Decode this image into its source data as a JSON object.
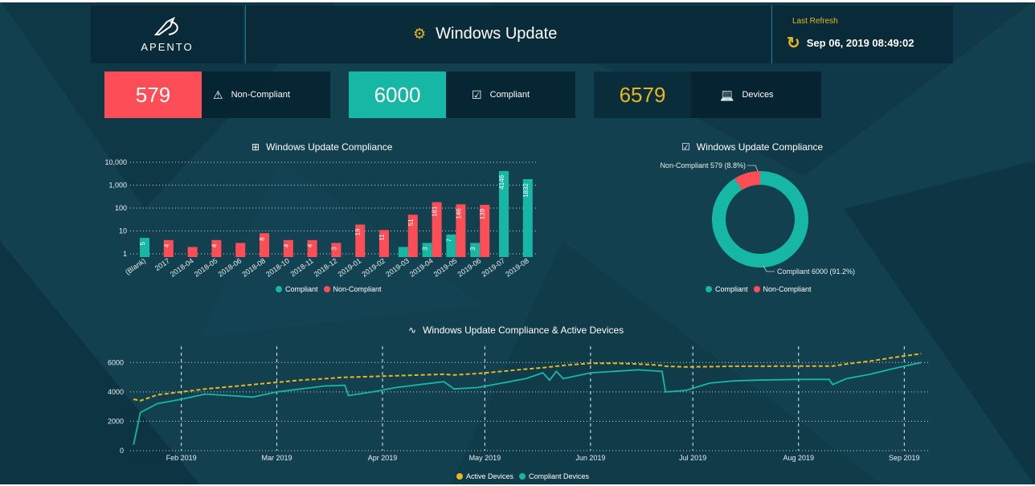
{
  "header": {
    "logo_text": "APENTO",
    "title": "Windows Update",
    "refresh_label": "Last Refresh",
    "refresh_time": "Sep 06, 2019 08:49:02"
  },
  "kpis": [
    {
      "value": "579",
      "label": "Non-Compliant",
      "icon": "warning-icon",
      "color": "#fd4d57"
    },
    {
      "value": "6000",
      "label": "Compliant",
      "icon": "checkbox-icon",
      "color": "#17b7a5"
    },
    {
      "value": "6579",
      "label": "Devices",
      "icon": "laptop-icon",
      "color": "#e8b620"
    }
  ],
  "colors": {
    "compliant": "#17b7a5",
    "noncompliant": "#fd4d57",
    "active": "#e8b620"
  },
  "bar_panel": {
    "title": "Windows Update Compliance",
    "legend": [
      "Compliant",
      "Non-Compliant"
    ]
  },
  "donut_panel": {
    "title": "Windows Update Compliance",
    "label_noncompliant": "Non-Compliant 579 (8.8%)",
    "label_compliant": "Compliant 6000 (91.2%)",
    "legend": [
      "Compliant",
      "Non-Compliant"
    ]
  },
  "line_panel": {
    "title": "Windows Update Compliance & Active Devices",
    "legend": [
      "Active Devices",
      "Compliant Devices"
    ]
  },
  "chart_data": [
    {
      "type": "bar",
      "title": "Windows Update Compliance",
      "y_scale": "log",
      "y_ticks": [
        "1",
        "10",
        "100",
        "1,000",
        "10,000"
      ],
      "categories": [
        "(Blank)",
        "2017",
        "2018-04",
        "2018-05",
        "2018-06",
        "2018-08",
        "2018-10",
        "2018-11",
        "2018-12",
        "2019-01",
        "2019-02",
        "2019-03",
        "2019-04",
        "2019-05",
        "2019-06",
        "2019-07",
        "2019-08"
      ],
      "series": [
        {
          "name": "Compliant",
          "values": [
            5,
            null,
            null,
            null,
            null,
            null,
            null,
            null,
            null,
            null,
            null,
            2,
            3,
            7,
            3,
            4146,
            1832
          ]
        },
        {
          "name": "Non-Compliant",
          "values": [
            null,
            4,
            2,
            4,
            3,
            8,
            4,
            4,
            3,
            19,
            11,
            51,
            181,
            146,
            139,
            null,
            null
          ]
        }
      ],
      "data_labels": [
        {
          "series": 0,
          "index": 0,
          "text": "5"
        },
        {
          "series": 1,
          "index": 1,
          "text": "4"
        },
        {
          "series": 1,
          "index": 3,
          "text": "4"
        },
        {
          "series": 1,
          "index": 5,
          "text": "8"
        },
        {
          "series": 1,
          "index": 6,
          "text": "4"
        },
        {
          "series": 1,
          "index": 7,
          "text": "4"
        },
        {
          "series": 1,
          "index": 8,
          "text": "3"
        },
        {
          "series": 1,
          "index": 9,
          "text": "19"
        },
        {
          "series": 1,
          "index": 10,
          "text": "11"
        },
        {
          "series": 1,
          "index": 11,
          "text": "51"
        },
        {
          "series": 0,
          "index": 12,
          "text": "3"
        },
        {
          "series": 1,
          "index": 12,
          "text": "181"
        },
        {
          "series": 0,
          "index": 13,
          "text": "7"
        },
        {
          "series": 1,
          "index": 13,
          "text": "146"
        },
        {
          "series": 0,
          "index": 14,
          "text": "3"
        },
        {
          "series": 1,
          "index": 14,
          "text": "139"
        },
        {
          "series": 0,
          "index": 15,
          "text": "4146"
        },
        {
          "series": 0,
          "index": 16,
          "text": "1832"
        }
      ],
      "grid": true,
      "legend_position": "bottom"
    },
    {
      "type": "pie",
      "title": "Windows Update Compliance",
      "categories": [
        "Compliant",
        "Non-Compliant"
      ],
      "values": [
        6000,
        579
      ],
      "legend_position": "bottom"
    },
    {
      "type": "line",
      "title": "Windows Update Compliance & Active Devices",
      "x_ticks": [
        "Feb 2019",
        "Mar 2019",
        "Apr 2019",
        "May 2019",
        "Jun 2019",
        "Jul 2019",
        "Aug 2019",
        "Sep 2019"
      ],
      "y_ticks": [
        0,
        2000,
        4000,
        6000
      ],
      "ylim": [
        0,
        7000
      ],
      "x": [
        "2019-01-18",
        "2019-01-20",
        "2019-01-25",
        "2019-02-01",
        "2019-02-08",
        "2019-02-15",
        "2019-02-22",
        "2019-03-01",
        "2019-03-08",
        "2019-03-15",
        "2019-03-21",
        "2019-03-22",
        "2019-03-29",
        "2019-04-05",
        "2019-04-12",
        "2019-04-19",
        "2019-04-22",
        "2019-04-29",
        "2019-05-06",
        "2019-05-13",
        "2019-05-18",
        "2019-05-20",
        "2019-05-22",
        "2019-05-24",
        "2019-06-01",
        "2019-06-08",
        "2019-06-15",
        "2019-06-22",
        "2019-06-23",
        "2019-06-29",
        "2019-07-06",
        "2019-07-13",
        "2019-07-20",
        "2019-08-01",
        "2019-08-10",
        "2019-08-11",
        "2019-08-15",
        "2019-08-22",
        "2019-08-29",
        "2019-09-06"
      ],
      "series": [
        {
          "name": "Active Devices",
          "values": [
            3500,
            3400,
            3800,
            4000,
            4200,
            4350,
            4500,
            4650,
            4800,
            4900,
            5000,
            5000,
            5050,
            5100,
            5150,
            5200,
            5150,
            5250,
            5400,
            5550,
            5650,
            5700,
            5750,
            5800,
            5950,
            5950,
            5900,
            5800,
            5750,
            5700,
            5720,
            5750,
            5750,
            5760,
            5760,
            5760,
            5900,
            6100,
            6350,
            6600
          ]
        },
        {
          "name": "Compliant Devices",
          "values": [
            400,
            2600,
            3200,
            3500,
            3850,
            3750,
            3650,
            4000,
            4200,
            4400,
            4450,
            3750,
            4000,
            4300,
            4500,
            4700,
            4200,
            4300,
            4600,
            4900,
            5300,
            4800,
            5400,
            4900,
            5300,
            5400,
            5500,
            5400,
            4000,
            4100,
            4600,
            4750,
            4800,
            4850,
            4850,
            4500,
            4900,
            5200,
            5600,
            6000
          ]
        }
      ],
      "grid": true,
      "legend_position": "bottom"
    }
  ]
}
